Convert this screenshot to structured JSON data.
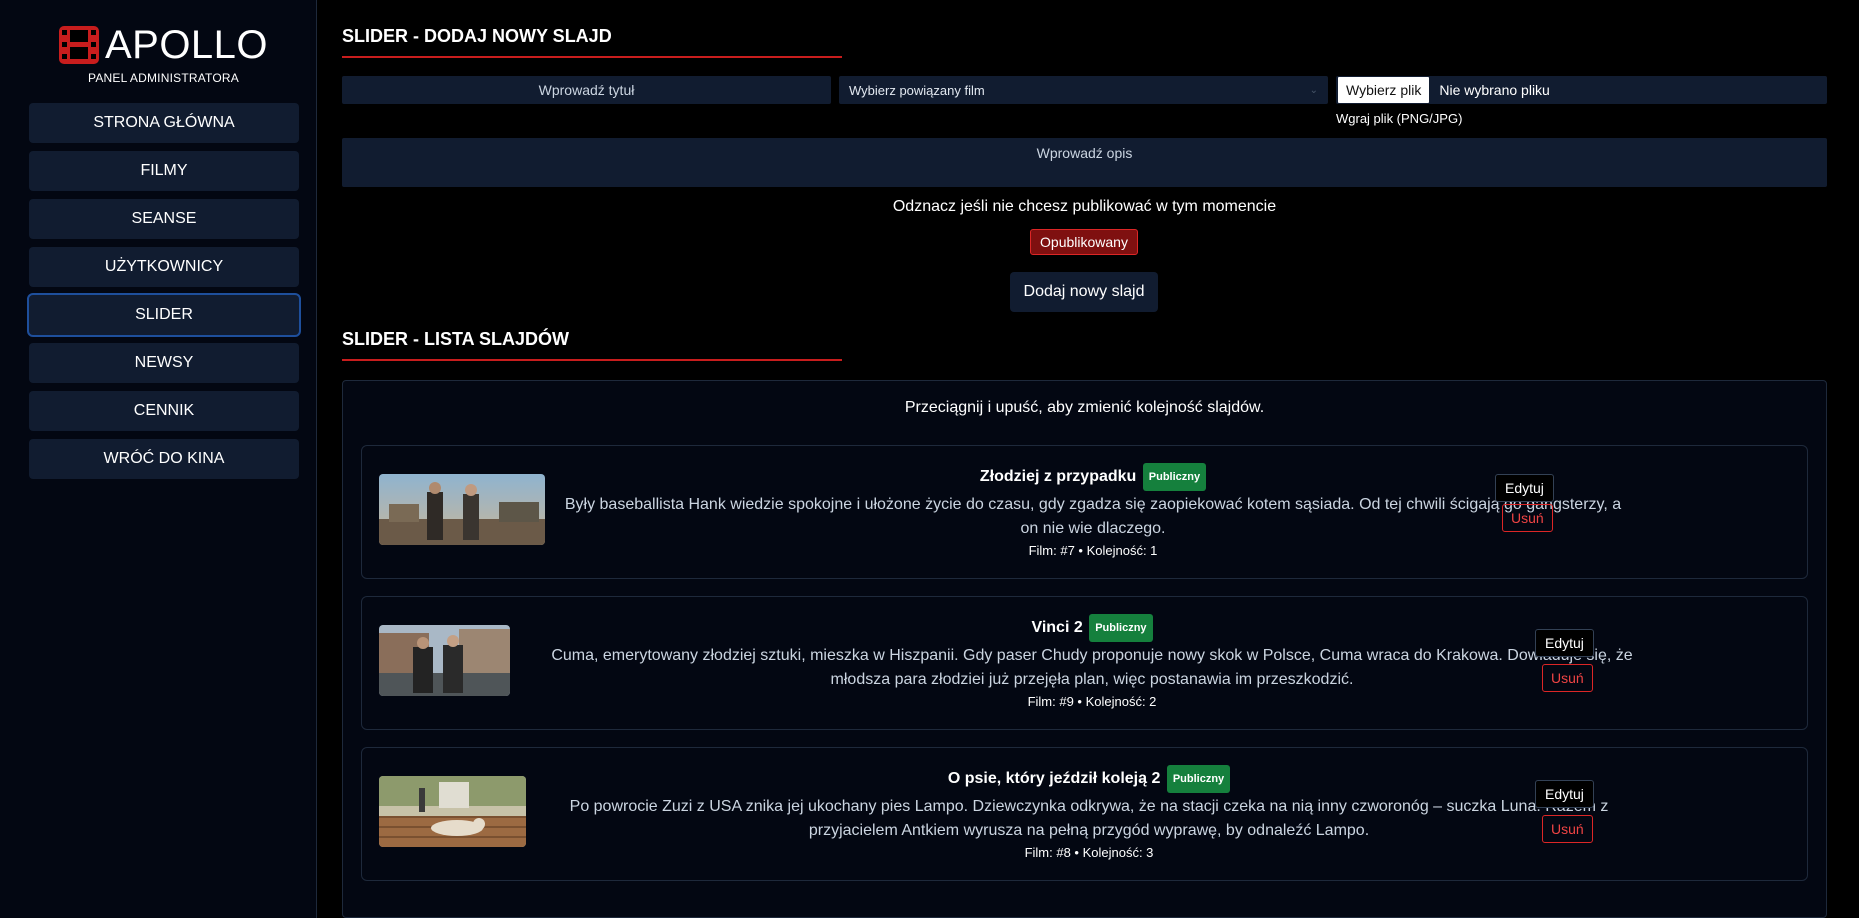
{
  "sidebar": {
    "brand": "APOLLO",
    "subtitle": "PANEL ADMINISTRATORA",
    "items": [
      {
        "label": "STRONA GŁÓWNA"
      },
      {
        "label": "FILMY"
      },
      {
        "label": "SEANSE"
      },
      {
        "label": "UŻYTKOWNICY"
      },
      {
        "label": "SLIDER",
        "active": true
      },
      {
        "label": "NEWSY"
      },
      {
        "label": "CENNIK"
      },
      {
        "label": "WRÓĆ DO KINA"
      }
    ]
  },
  "add_form": {
    "heading": "SLIDER - DODAJ NOWY SLAJD",
    "title_placeholder": "Wprowadź tytuł",
    "film_select": "Wybierz powiązany film",
    "file_button": "Wybierz plik",
    "file_status": "Nie wybrano pliku",
    "file_hint": "Wgraj plik (PNG/JPG)",
    "desc_placeholder": "Wprowadź opis",
    "publish_note": "Odznacz jeśli nie chcesz publikować w tym momencie",
    "publish_toggle": "Opublikowany",
    "submit": "Dodaj nowy slajd"
  },
  "list": {
    "heading": "SLIDER - LISTA SLAJDÓW",
    "hint": "Przeciągnij i upuść, aby zmienić kolejność slajdów.",
    "slides": [
      {
        "title": "Złodziej z przypadku",
        "badge": "Publiczny",
        "description": "Były baseballista Hank wiedzie spokojne i ułożone życie do czasu, gdy zgadza się zaopiekować kotem sąsiada. Od tej chwili ścigają go gangsterzy, a on nie wie dlaczego.",
        "meta": "Film: #7 • Kolejność: 1",
        "edit": "Edytuj",
        "delete": "Usuń"
      },
      {
        "title": "Vinci 2",
        "badge": "Publiczny",
        "description": "Cuma, emerytowany złodziej sztuki, mieszka w Hiszpanii. Gdy paser Chudy proponuje nowy skok w Polsce, Cuma wraca do Krakowa. Dowiaduje się, że młodsza para złodziei już przejęła plan, więc postanawia im przeszkodzić.",
        "meta": "Film: #9 • Kolejność: 2",
        "edit": "Edytuj",
        "delete": "Usuń"
      },
      {
        "title": "O psie, który jeździł koleją 2",
        "badge": "Publiczny",
        "description": "Po powrocie Zuzi z USA znika jej ukochany pies Lampo. Dziewczynka odkrywa, że na stacji czeka na nią inny czworonóg – suczka Luna. Razem z przyjacielem Antkiem wyrusza na pełną przygód wyprawę, by odnaleźć Lampo.",
        "meta": "Film: #8 • Kolejność: 3",
        "edit": "Edytuj",
        "delete": "Usuń"
      }
    ]
  },
  "colors": {
    "accent": "#c81d1d",
    "panel": "#111c30",
    "badge": "#15803d",
    "active_border": "#1e4f9c"
  },
  "icons": {
    "logo": "film-reel-icon",
    "select": "chevron-down-icon"
  }
}
